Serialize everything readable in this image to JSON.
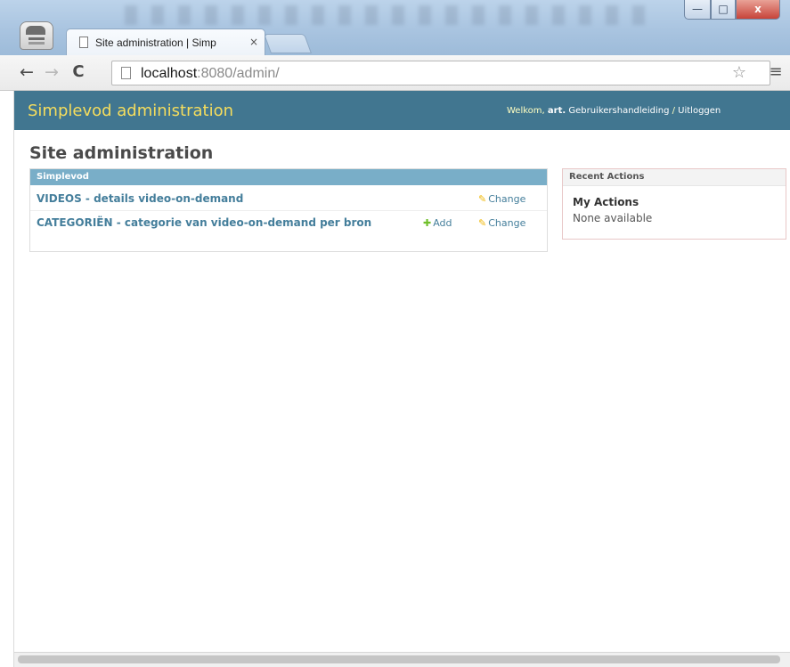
{
  "browser": {
    "tab_title": "Site administration | Simp",
    "tab_close": "×",
    "url_host": "localhost",
    "url_rest": ":8080/admin/",
    "window_controls": {
      "minimize": "—",
      "maximize": "□",
      "close": "x"
    },
    "nav": {
      "back": "←",
      "forward": "→",
      "reload": "C",
      "star": "☆",
      "menu": "≡"
    }
  },
  "header": {
    "branding": "Simplevod administration",
    "welcome": "Welkom,",
    "username": "art.",
    "docs_link": "Gebruikershandleiding",
    "separator": " / ",
    "logout_link": "Uitloggen"
  },
  "page": {
    "title": "Site administration"
  },
  "app_module": {
    "caption": "Simplevod",
    "models": [
      {
        "name": "VIDEOS - details video-on-demand",
        "change_label": "Change"
      },
      {
        "name": "CATEGORIËN - categorie van video-on-demand per bron",
        "add_label": "Add",
        "change_label": "Change"
      }
    ]
  },
  "recent_actions": {
    "caption": "Recent Actions",
    "my_actions": "My Actions",
    "empty_text": "None available"
  },
  "colors": {
    "header_bg": "#417690",
    "branding": "#f5dd5d",
    "caption_bg": "#79aec8",
    "link": "#447e9b",
    "add_icon": "#70bf2b",
    "change_icon": "#efb80b"
  },
  "icons": {
    "change": "pencil-icon",
    "add": "plus-icon",
    "page": "page-icon",
    "star": "star-icon",
    "menu": "hamburger-menu-icon"
  }
}
